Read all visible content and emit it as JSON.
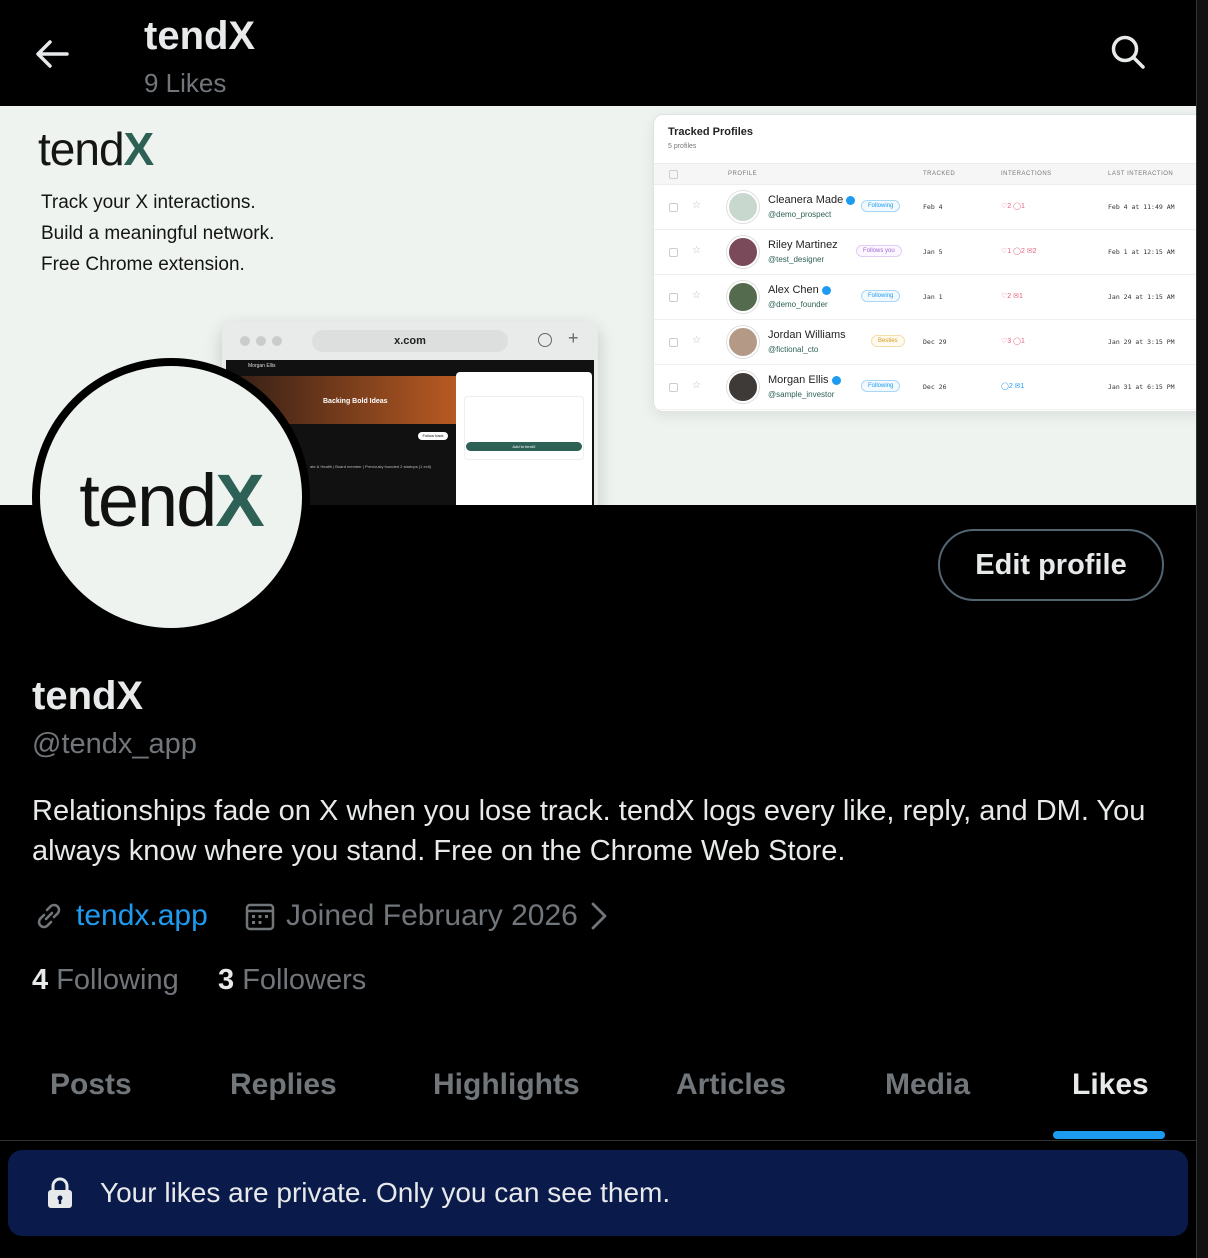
{
  "header": {
    "title": "tendX",
    "subtitle": "9 Likes",
    "back_icon": "arrow-left-icon",
    "search_icon": "search-icon"
  },
  "banner": {
    "logo_prefix": "tend",
    "logo_x": "X",
    "lines": [
      "Track your X interactions.",
      "Build a meaningful network.",
      "Free Chrome extension."
    ],
    "tracked_card": {
      "title": "Tracked Profiles",
      "count": "5 profiles",
      "columns": [
        "PROFILE",
        "TRACKED",
        "INTERACTIONS",
        "LAST INTERACTION"
      ],
      "rows": [
        {
          "name": "Cleanera Made",
          "handle": "@demo_prospect",
          "badge": "Following",
          "tracked": "Feb 4",
          "interactions": "♡2 ◯1",
          "last": "Feb 4 at 11:49 AM"
        },
        {
          "name": "Riley Martinez",
          "handle": "@test_designer",
          "badge": "Follows you",
          "tracked": "Jan 5",
          "interactions": "♡1 ◯2 ✉2",
          "last": "Feb 1 at 12:15 AM"
        },
        {
          "name": "Alex Chen",
          "handle": "@demo_founder",
          "badge": "Following",
          "tracked": "Jan 1",
          "interactions": "♡2 ✉1",
          "last": "Jan 24 at 1:15 AM"
        },
        {
          "name": "Jordan Williams",
          "handle": "@fictional_cto",
          "badge": "Besties",
          "tracked": "Dec 29",
          "interactions": "♡3 ◯1",
          "last": "Jan 29 at 3:15 PM"
        },
        {
          "name": "Morgan Ellis",
          "handle": "@sample_investor",
          "badge": "Following",
          "tracked": "Dec 26",
          "interactions": "◯2 ✉1",
          "last": "Jan 31 at 6:15 PM"
        }
      ]
    },
    "browser": {
      "url": "x.com",
      "cover_text": "Backing Bold Ideas",
      "profile_name": "Morgan Ellis",
      "follow_label": "Follow back",
      "bio_snippet": "ate & Health | Board member | Previously founded 2 startups (1 exit)",
      "panel_cta": "Add to tendX"
    }
  },
  "avatar": {
    "logo_prefix": "tend",
    "logo_x": "X"
  },
  "profile": {
    "edit_label": "Edit profile",
    "name": "tendX",
    "handle": "@tendx_app",
    "bio": "Relationships fade on X when you lose track. tendX logs every like, reply, and DM. You always know where you stand. Free on the Chrome Web Store.",
    "link_icon": "link-icon",
    "link": "tendx.app",
    "calendar_icon": "calendar-icon",
    "joined": "Joined February 2026",
    "following_count": "4",
    "following_label": "Following",
    "followers_count": "3",
    "followers_label": "Followers"
  },
  "tabs": [
    "Posts",
    "Replies",
    "Highlights",
    "Articles",
    "Media",
    "Likes"
  ],
  "active_tab": "Likes",
  "notice": {
    "icon": "lock-icon",
    "text": "Your likes are private. Only you can see them."
  },
  "colors": {
    "accent": "#1d9bf0",
    "brand": "#2e6156",
    "notice_bg": "#0a1a4a"
  }
}
